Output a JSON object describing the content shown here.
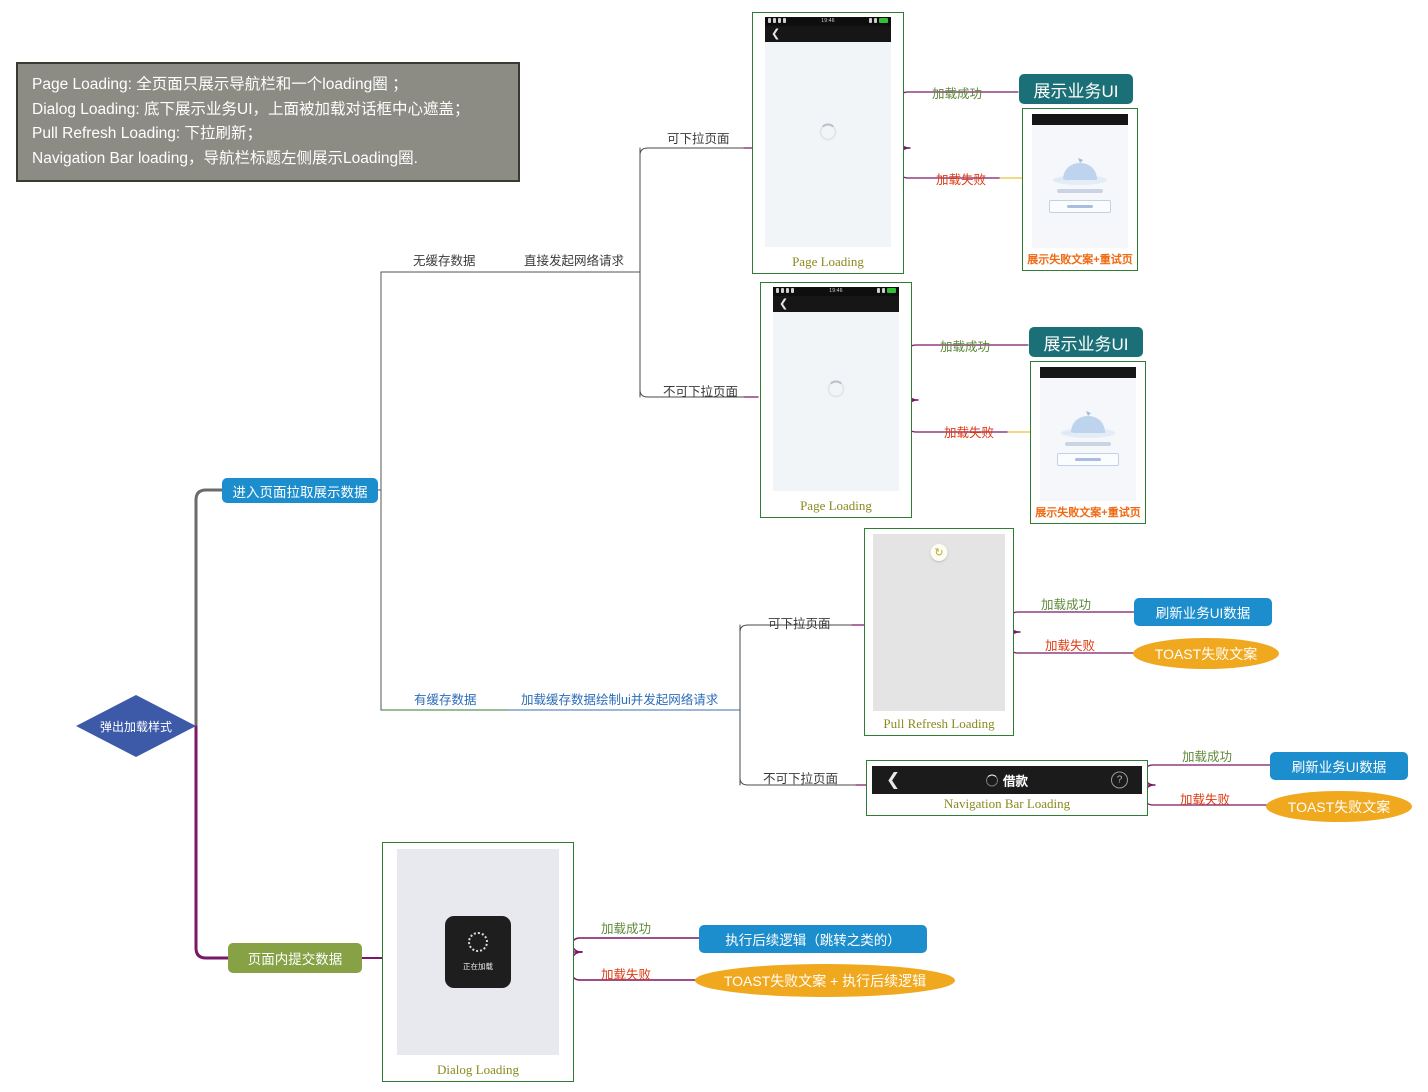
{
  "legend": {
    "lines": [
      "Page Loading: 全页面只展示导航栏和一个loading圈 ；",
      "Dialog Loading: 底下展示业务UI，上面被加载对话框中心遮盖；",
      "Pull Refresh Loading: 下拉刷新；",
      "Navigation Bar loading，导航栏标题左侧展示Loading圈."
    ],
    "bg": "#8c8c84",
    "border": "#3a3a33"
  },
  "root": {
    "label": "弹出加载样式",
    "color": "#3c5aa8"
  },
  "branches": {
    "enter_page": {
      "label": "进入页面拉取展示数据",
      "color": "#1d8ecd"
    },
    "submit_page": {
      "label": "页面内提交数据",
      "color": "#87a145"
    }
  },
  "cache_labels": {
    "no_cache": "无缓存数据",
    "no_cache_action": "直接发起网络请求",
    "has_cache": "有缓存数据",
    "has_cache_action": "加载缓存数据绘制ui并发起网络请求"
  },
  "pull_labels": {
    "pullable": "可下拉页面",
    "not_pullable": "不可下拉页面"
  },
  "result_labels": {
    "success": "加载成功",
    "fail": "加载失败"
  },
  "mockups": {
    "page_loading_1": {
      "caption": "Page Loading",
      "status_time": "19:46",
      "status_battery": "75%",
      "back_icon": "chevron-left-icon",
      "spinner_icon": "spinner-icon"
    },
    "page_loading_2": {
      "caption": "Page Loading",
      "status_time": "19:46",
      "status_battery": "75%",
      "back_icon": "chevron-left-icon",
      "spinner_icon": "spinner-icon"
    },
    "error_page_1": {
      "caption": "展示失败文案+重试页",
      "color": "#ef6a12"
    },
    "error_page_2": {
      "caption": "展示失败文案+重试页",
      "color": "#ef6a12"
    },
    "pull_refresh": {
      "caption": "Pull Refresh Loading",
      "badge_icon": "refresh-spinner-icon"
    },
    "nav_bar": {
      "caption": "Navigation Bar Loading",
      "title": "借款",
      "back_icon": "chevron-left-icon",
      "help_icon": "question-mark-icon",
      "spinner_icon": "spinner-icon"
    },
    "dialog": {
      "caption": "Dialog Loading",
      "dialog_text": "正在加载",
      "spinner_icon": "spinner-icon"
    }
  },
  "outcomes": {
    "show_business_ui_1": {
      "label": "展示业务UI",
      "color": "#1b6f76"
    },
    "show_business_ui_2": {
      "label": "展示业务UI",
      "color": "#1b6f76"
    },
    "refresh_ui_data_1": {
      "label": "刷新业务UI数据",
      "color": "#1d8ecd"
    },
    "toast_fail_1": {
      "label": "TOAST失败文案",
      "color": "#f0a81e"
    },
    "refresh_ui_data_2": {
      "label": "刷新业务UI数据",
      "color": "#1d8ecd"
    },
    "toast_fail_2": {
      "label": "TOAST失败文案",
      "color": "#f0a81e"
    },
    "follow_logic": {
      "label": "执行后续逻辑（跳转之类的）",
      "color": "#1d8ecd"
    },
    "toast_plus_logic": {
      "label": "TOAST失败文案 + 执行后续逻辑",
      "color": "#f0a81e"
    }
  }
}
